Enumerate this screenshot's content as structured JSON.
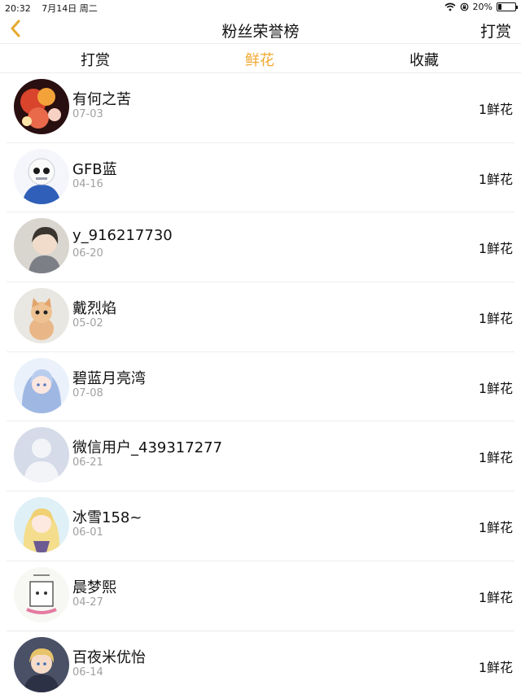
{
  "status_bar": {
    "time": "20:32",
    "date": "7月14日 周二",
    "battery_text": "20%",
    "battery_level": 0.2
  },
  "nav": {
    "title": "粉丝荣誉榜",
    "right_label": "打赏",
    "accent": "#f0a830"
  },
  "tabs": [
    {
      "label": "打赏",
      "active": false
    },
    {
      "label": "鲜花",
      "active": true
    },
    {
      "label": "收藏",
      "active": false
    }
  ],
  "fans": [
    {
      "name": "有何之苦",
      "date": "07-03",
      "count": "1鲜花",
      "avatar": "flower-fire-avatar"
    },
    {
      "name": "GFB蓝",
      "date": "04-16",
      "count": "1鲜花",
      "avatar": "skull-hoodie-avatar"
    },
    {
      "name": "y_916217730",
      "date": "06-20",
      "count": "1鲜花",
      "avatar": "anime-boy-avatar"
    },
    {
      "name": "戴烈焰",
      "date": "05-02",
      "count": "1鲜花",
      "avatar": "kitten-avatar"
    },
    {
      "name": "碧蓝月亮湾",
      "date": "07-08",
      "count": "1鲜花",
      "avatar": "anime-girl-blue-hair-avatar"
    },
    {
      "name": "微信用户_439317277",
      "date": "06-21",
      "count": "1鲜花",
      "avatar": "default-user-avatar"
    },
    {
      "name": "冰雪158~",
      "date": "06-01",
      "count": "1鲜花",
      "avatar": "anime-girl-blonde-avatar"
    },
    {
      "name": "晨梦熙",
      "date": "04-27",
      "count": "1鲜花",
      "avatar": "sketch-character-avatar"
    },
    {
      "name": "百夜米优怡",
      "date": "06-14",
      "count": "1鲜花",
      "avatar": "anime-boy-blonde-avatar"
    }
  ]
}
